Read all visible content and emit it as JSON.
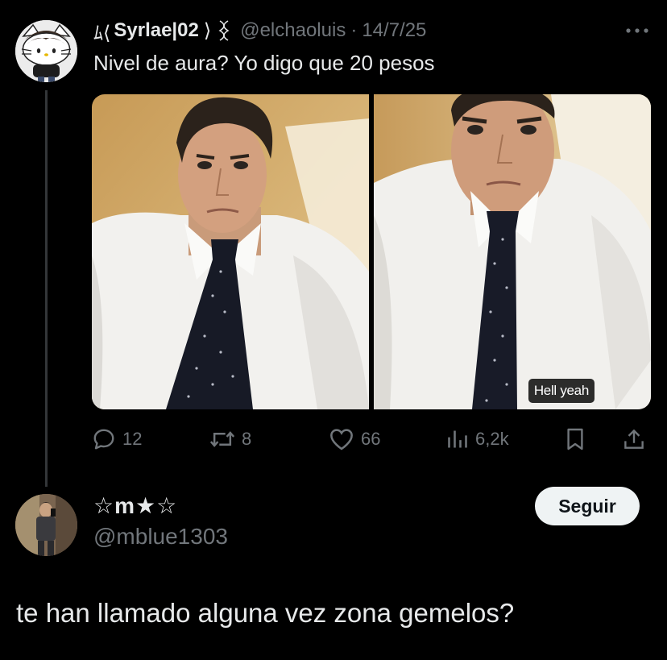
{
  "tweet": {
    "avatar_icon": "hello-kitty-avatar",
    "prefix_symbol": "ﾑ⟨",
    "display_name": "Syrlae|02",
    "suffix_symbol": "⟩",
    "handle": "@elchaoluis",
    "separator": "·",
    "date": "14/7/25",
    "more_icon": "more-horizontal-icon",
    "text": "Nivel de aura? Yo digo que 20 pesos",
    "media": [
      {
        "icon": "selfie-photo"
      },
      {
        "icon": "selfie-photo",
        "badge": "Hell yeah"
      }
    ],
    "actions": {
      "replies": "12",
      "reposts": "8",
      "likes": "66",
      "views": "6,2k"
    }
  },
  "reply": {
    "avatar_icon": "mirror-selfie-avatar",
    "display_name": "☆m★☆",
    "handle": "@mblue1303",
    "follow_label": "Seguir",
    "text": "te han llamado alguna vez zona gemelos?"
  },
  "colors": {
    "background": "#000000",
    "text": "#e7e9ea",
    "secondary": "#71767b",
    "thread_line": "#333639",
    "follow_bg": "#eff3f4"
  }
}
